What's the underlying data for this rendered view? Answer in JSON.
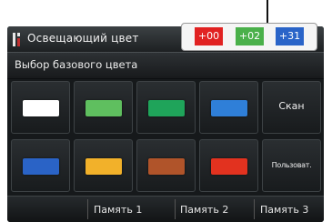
{
  "header": {
    "title": "Освещающий цвет",
    "back_icon": "↩"
  },
  "subheader": {
    "label": "Выбор базового цвета"
  },
  "values": {
    "red": "+00",
    "green": "+02",
    "blue": "+31"
  },
  "swatches": {
    "row1": [
      "#ffffff",
      "#5fbf5f",
      "#1fa45a",
      "#2f7fd8"
    ],
    "row2": [
      "#2a63c6",
      "#f2b12a",
      "#b0542a",
      "#e2321f"
    ]
  },
  "buttons": {
    "scan": "Скан",
    "custom": "Пользоват."
  },
  "memory": [
    "Память 1",
    "Память 2",
    "Память 3"
  ],
  "colors": {
    "value_red": "#e12222",
    "value_green": "#4ab04a",
    "value_blue": "#2a64c8"
  }
}
